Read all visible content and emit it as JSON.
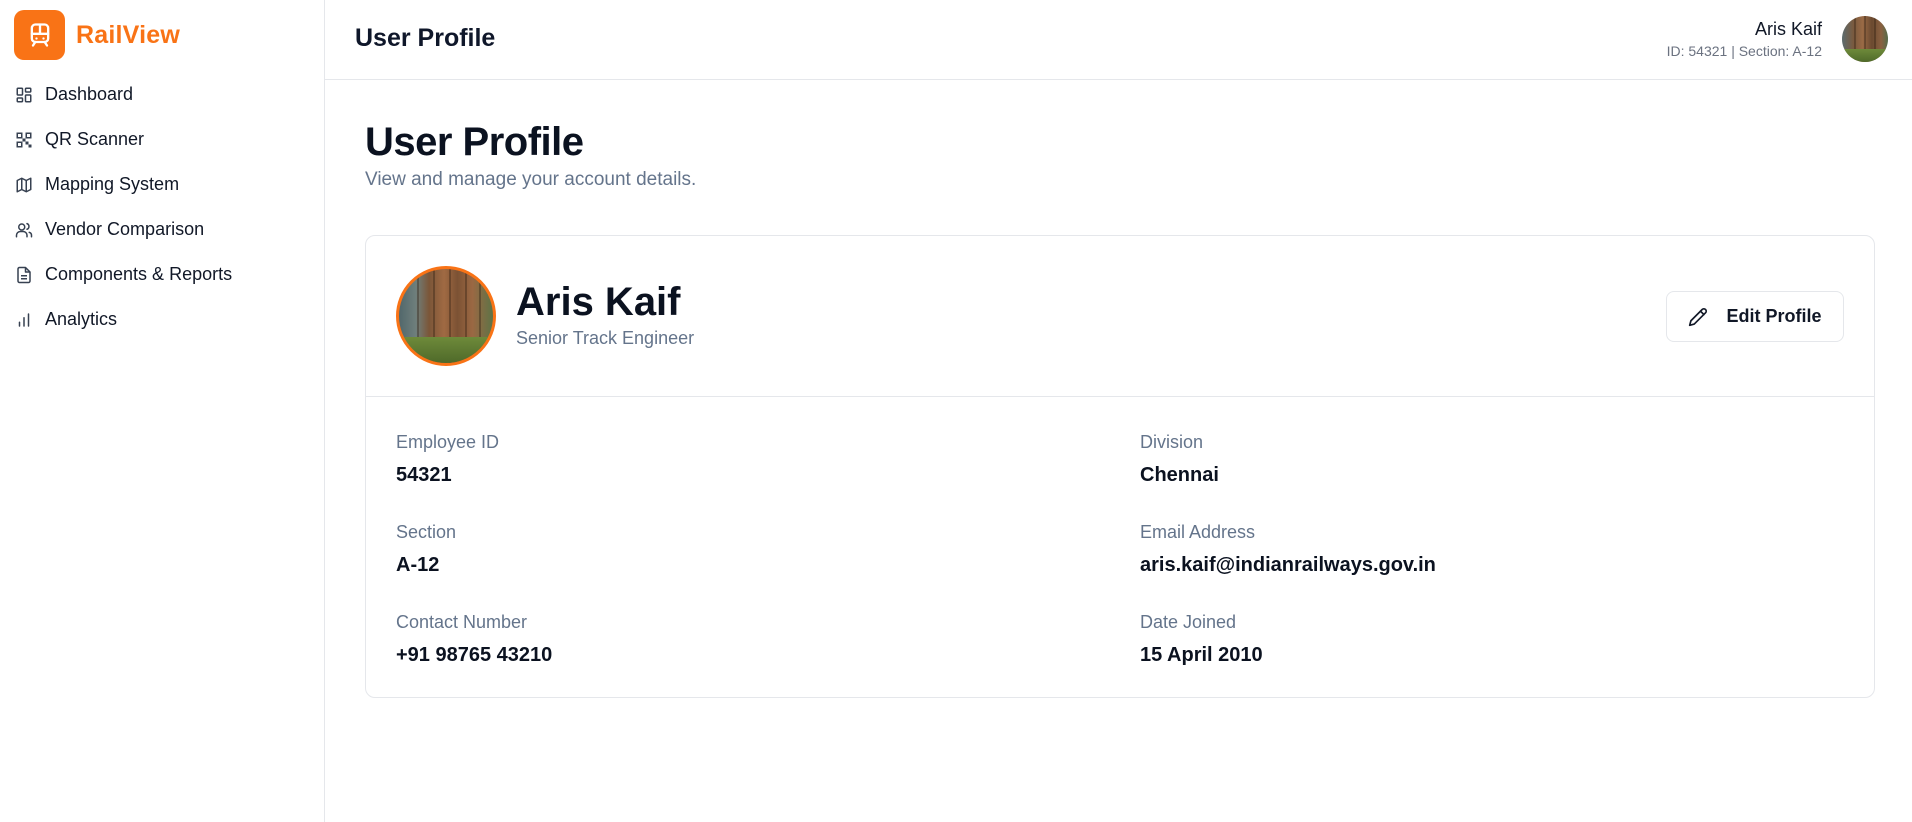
{
  "brand": {
    "name": "RailView",
    "accent": "#f97316",
    "icon": "train-icon"
  },
  "sidebar": {
    "items": [
      {
        "label": "Dashboard",
        "icon": "dashboard-icon"
      },
      {
        "label": "QR Scanner",
        "icon": "qr-code-icon"
      },
      {
        "label": "Mapping System",
        "icon": "map-icon"
      },
      {
        "label": "Vendor Comparison",
        "icon": "users-icon"
      },
      {
        "label": "Components & Reports",
        "icon": "document-icon"
      },
      {
        "label": "Analytics",
        "icon": "bar-chart-icon"
      }
    ]
  },
  "header": {
    "title": "User Profile",
    "user_name": "Aris Kaif",
    "user_meta": "ID: 54321 | Section: A-12"
  },
  "main": {
    "title": "User Profile",
    "subtitle": "View and manage your account details."
  },
  "profile": {
    "name": "Aris Kaif",
    "role": "Senior Track Engineer",
    "edit_label": "Edit Profile",
    "fields": [
      {
        "label": "Employee ID",
        "value": "54321"
      },
      {
        "label": "Division",
        "value": "Chennai"
      },
      {
        "label": "Section",
        "value": "A-12"
      },
      {
        "label": "Email Address",
        "value": "aris.kaif@indianrailways.gov.in"
      },
      {
        "label": "Contact Number",
        "value": "+91 98765 43210"
      },
      {
        "label": "Date Joined",
        "value": "15 April 2010"
      }
    ]
  }
}
